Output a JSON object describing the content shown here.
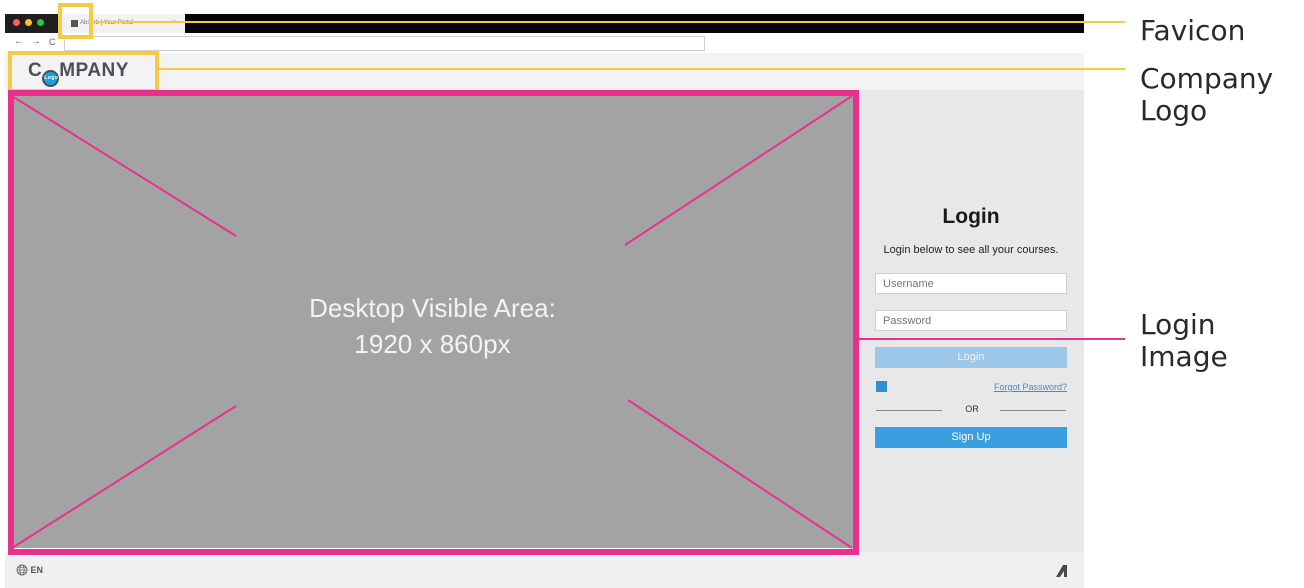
{
  "browser": {
    "tab_title": "Absorb | Your Portal",
    "tab_close": "×",
    "nav_back": "←",
    "nav_forward": "→",
    "nav_reload": "C",
    "url": ""
  },
  "header": {
    "logo_prefix": "C",
    "logo_badge": "Logo",
    "logo_suffix": "MPANY"
  },
  "hero": {
    "line1": "Desktop Visible Area:",
    "line2": "1920 x 860px"
  },
  "login": {
    "title": "Login",
    "subtitle": "Login below to see all your courses.",
    "username_placeholder": "Username",
    "password_placeholder": "Password",
    "login_button": "Login",
    "forgot_link": "Forgot Password?",
    "or_text": "OR",
    "signup_button": "Sign Up"
  },
  "footer": {
    "language": "EN"
  },
  "annotations": {
    "favicon": "Favicon",
    "company_logo_line1": "Company",
    "company_logo_line2": "Logo",
    "login_image_line1": "Login",
    "login_image_line2": "Image"
  },
  "colors": {
    "highlight_yellow": "#f7c948",
    "highlight_pink": "#e8318d",
    "login_button_disabled": "#9cc7e8",
    "signup_button": "#3b9ee0",
    "hero_placeholder": "#a3a3a3"
  }
}
